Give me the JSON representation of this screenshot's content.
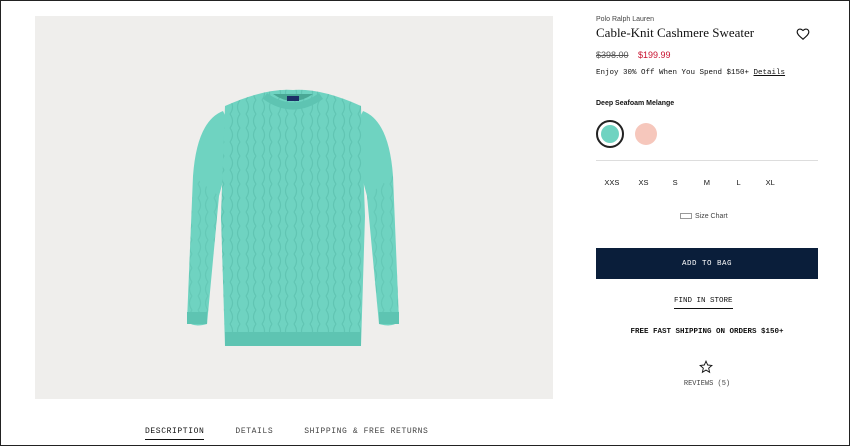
{
  "product": {
    "brand": "Polo Ralph Lauren",
    "title": "Cable-Knit Cashmere Sweater",
    "old_price": "$398.00",
    "new_price": "$199.99",
    "promo_text": "Enjoy 30% Off When You Spend $150+ ",
    "promo_link": "Details",
    "color_name": "Deep Seafoam Melange",
    "swatches": [
      {
        "name": "Deep Seafoam Melange",
        "color": "#6fd3c1",
        "selected": true
      },
      {
        "name": "Pink",
        "color": "#f6c7bc",
        "selected": false
      }
    ],
    "sizes": [
      "XXS",
      "XS",
      "S",
      "M",
      "L",
      "XL"
    ],
    "size_chart_label": "Size Chart",
    "add_to_bag_label": "ADD TO BAG",
    "find_in_store_label": "FIND IN STORE",
    "shipping_text": "FREE FAST SHIPPING ON ORDERS $150+",
    "reviews_label": "REVIEWS (5)"
  },
  "tabs": [
    {
      "label": "DESCRIPTION",
      "active": true
    },
    {
      "label": "DETAILS",
      "active": false
    },
    {
      "label": "SHIPPING & FREE RETURNS",
      "active": false
    }
  ],
  "colors": {
    "accent": "#0a1e3a",
    "sale": "#c8102e",
    "sweater": "#6fd3c1",
    "image_bg": "#efeeec"
  },
  "icons": {
    "wishlist": "heart-icon",
    "reviews": "star-icon",
    "size_chart": "ruler-icon"
  }
}
